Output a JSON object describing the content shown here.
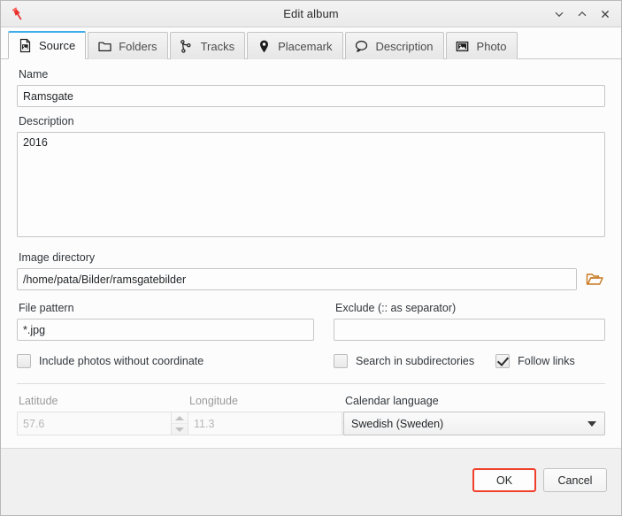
{
  "window": {
    "title": "Edit album",
    "app_icon": "pushpin-icon",
    "controls": [
      {
        "name": "minimize",
        "glyph": "chevron-down-icon"
      },
      {
        "name": "maximize",
        "glyph": "chevron-up-icon"
      },
      {
        "name": "close",
        "glyph": "close-icon"
      }
    ]
  },
  "tabs": [
    {
      "label": "Source",
      "icon": "image-file-icon",
      "active": true
    },
    {
      "label": "Folders",
      "icon": "folder-icon",
      "active": false
    },
    {
      "label": "Tracks",
      "icon": "track-branch-icon",
      "active": false
    },
    {
      "label": "Placemark",
      "icon": "map-pin-icon",
      "active": false
    },
    {
      "label": "Description",
      "icon": "speech-bubble-icon",
      "active": false
    },
    {
      "label": "Photo",
      "icon": "photo-icon",
      "active": false
    }
  ],
  "form": {
    "name_label": "Name",
    "name_value": "Ramsgate",
    "description_label": "Description",
    "description_value": "2016",
    "image_directory_label": "Image directory",
    "image_directory_value": "/home/pata/Bilder/ramsgatebilder",
    "browse_icon": "open-folder-icon",
    "file_pattern_label": "File pattern",
    "file_pattern_value": "*.jpg",
    "exclude_label": "Exclude (:: as separator)",
    "exclude_value": "",
    "checkboxes": [
      {
        "label": "Include photos without coordinate",
        "checked": false
      },
      {
        "label": "Search in subdirectories",
        "checked": false
      },
      {
        "label": "Follow links",
        "checked": true
      }
    ],
    "latitude_label": "Latitude",
    "latitude_value": "57.6",
    "longitude_label": "Longitude",
    "longitude_value": "11.3",
    "calendar_language_label": "Calendar language",
    "calendar_language_value": "Swedish (Sweden)"
  },
  "footer": {
    "ok_label": "OK",
    "cancel_label": "Cancel"
  },
  "colors": {
    "accent": "#3daee9",
    "default_button_border": "#f0402a",
    "app_icon": "#e8312a",
    "browse_icon": "#c87820"
  }
}
